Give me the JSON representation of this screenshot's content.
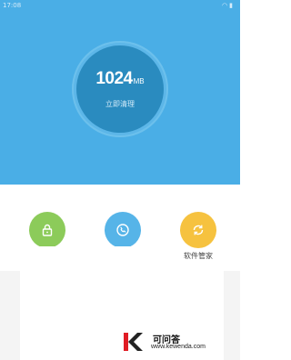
{
  "status_bar": {
    "time": "17:08"
  },
  "cleaner": {
    "size_value": "1024",
    "size_unit": "MB",
    "action_label": "立即清理"
  },
  "tools": [
    {
      "icon": "lock-icon",
      "label": "",
      "color": "#8ccb5a"
    },
    {
      "icon": "phone-shield-icon",
      "label": "",
      "color": "#56b4e8"
    },
    {
      "icon": "refresh-icon",
      "label": "软件管家",
      "color": "#f6c23f"
    }
  ],
  "colors": {
    "header_background": "#4aaee6",
    "ring_center": "#2a8bbf"
  },
  "watermark": {
    "title": "可问答",
    "url": "www.kewenda.com"
  }
}
